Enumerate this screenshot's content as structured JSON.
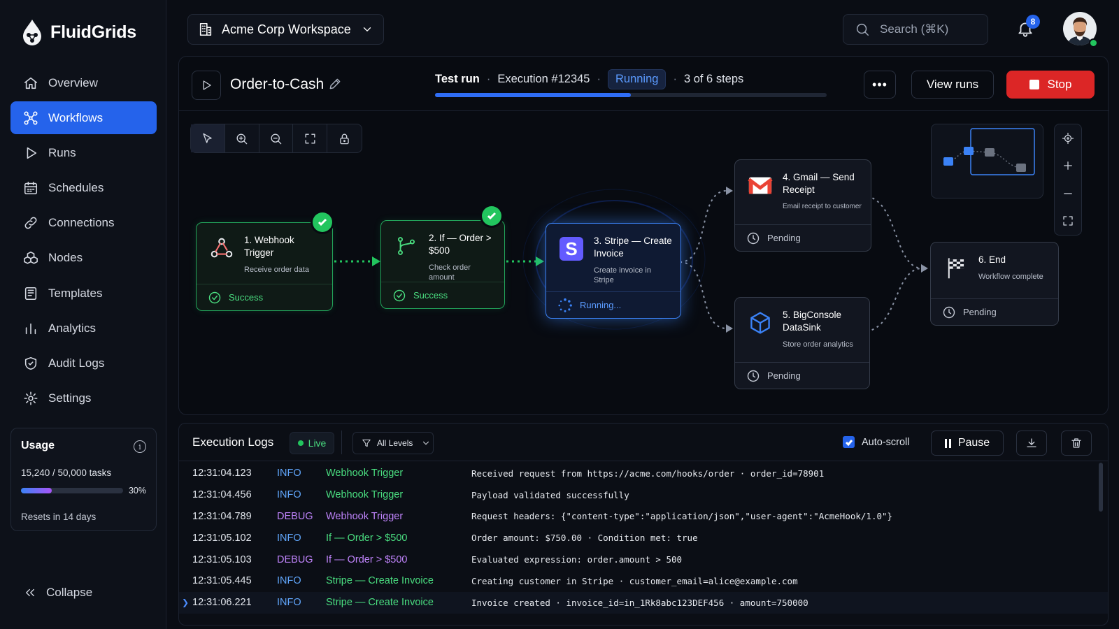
{
  "app": {
    "name": "FluidGrids"
  },
  "sidebar": {
    "items": [
      {
        "label": "Overview",
        "icon": "home-icon",
        "active": false
      },
      {
        "label": "Workflows",
        "icon": "workflow-icon",
        "active": true
      },
      {
        "label": "Runs",
        "icon": "play-icon",
        "active": false
      },
      {
        "label": "Schedules",
        "icon": "calendar-icon",
        "active": false
      },
      {
        "label": "Connections",
        "icon": "link-icon",
        "active": false
      },
      {
        "label": "Nodes",
        "icon": "cubes-icon",
        "active": false
      },
      {
        "label": "Templates",
        "icon": "template-icon",
        "active": false
      },
      {
        "label": "Analytics",
        "icon": "bar-chart-icon",
        "active": false
      },
      {
        "label": "Audit Logs",
        "icon": "shield-icon",
        "active": false
      },
      {
        "label": "Settings",
        "icon": "gear-icon",
        "active": false
      }
    ],
    "usage": {
      "title": "Usage",
      "tasks": "15,240 / 50,000 tasks",
      "percent_label": "30%",
      "fraction": 0.3,
      "reset": "Resets in 14 days"
    },
    "collapse_label": "Collapse"
  },
  "topbar": {
    "workspace": "Acme Corp Workspace",
    "search_placeholder": "Search (⌘K)",
    "notifications_count": "8"
  },
  "workflow": {
    "name": "Order-to-Cash",
    "run_type": "Test run",
    "execution": "Execution #12345",
    "status": "Running",
    "steps": "3 of 6 steps",
    "progress": 0.5,
    "more_label": "•••",
    "view_runs_label": "View runs",
    "stop_label": "Stop"
  },
  "nodes": [
    {
      "title": "1. Webhook Trigger",
      "subtitle": "Receive order data",
      "status": "Success",
      "state": "success",
      "icon": "webhook-icon"
    },
    {
      "title": "2. If — Order > $500",
      "subtitle": "Check order amount",
      "status": "Success",
      "state": "success",
      "icon": "branch-icon"
    },
    {
      "title": "3. Stripe — Create Invoice",
      "subtitle": "Create invoice in Stripe",
      "status": "Running...",
      "state": "running",
      "icon": "stripe-icon"
    },
    {
      "title": "4. Gmail — Send Receipt",
      "subtitle": "Email receipt to customer",
      "status": "Pending",
      "state": "pending",
      "icon": "gmail-icon"
    },
    {
      "title": "5. BigConsole DataSink",
      "subtitle": "Store order analytics",
      "status": "Pending",
      "state": "pending",
      "icon": "cube-icon"
    },
    {
      "title": "6. End",
      "subtitle": "Workflow complete",
      "status": "Pending",
      "state": "pending",
      "icon": "checkered-flag-icon"
    }
  ],
  "logs": {
    "title": "Execution Logs",
    "live_label": "Live",
    "filter_label": "All Levels",
    "autoscroll_label": "Auto-scroll",
    "autoscroll_checked": true,
    "pause_label": "Pause",
    "entries": [
      {
        "time": "12:31:04.123",
        "level": "INFO",
        "node": "Webhook Trigger",
        "message": "Received request from https://acme.com/hooks/order · order_id=78901",
        "node_color": "#4ade80"
      },
      {
        "time": "12:31:04.456",
        "level": "INFO",
        "node": "Webhook Trigger",
        "message": "Payload validated successfully",
        "node_color": "#4ade80"
      },
      {
        "time": "12:31:04.789",
        "level": "DEBUG",
        "node": "Webhook Trigger",
        "message": "Request headers: {\"content-type\":\"application/json\",\"user-agent\":\"AcmeHook/1.0\"}",
        "node_color": "#c084fc"
      },
      {
        "time": "12:31:05.102",
        "level": "INFO",
        "node": "If — Order > $500",
        "message": "Order amount: $750.00 · Condition met: true",
        "node_color": "#4ade80"
      },
      {
        "time": "12:31:05.103",
        "level": "DEBUG",
        "node": "If — Order > $500",
        "message": "Evaluated expression: order.amount > 500",
        "node_color": "#c084fc"
      },
      {
        "time": "12:31:05.445",
        "level": "INFO",
        "node": "Stripe — Create Invoice",
        "message": "Creating customer in Stripe · customer_email=alice@example.com",
        "node_color": "#4ade80"
      },
      {
        "time": "12:31:06.221",
        "level": "INFO",
        "node": "Stripe — Create Invoice",
        "message": "Invoice created · invoice_id=in_1Rk8abc123DEF456 · amount=750000",
        "node_color": "#4ade80",
        "current": true
      }
    ]
  },
  "colors": {
    "accent": "#2563eb",
    "success": "#22c55e",
    "danger": "#dc2626",
    "debug": "#c084fc",
    "info": "#60a5fa"
  }
}
